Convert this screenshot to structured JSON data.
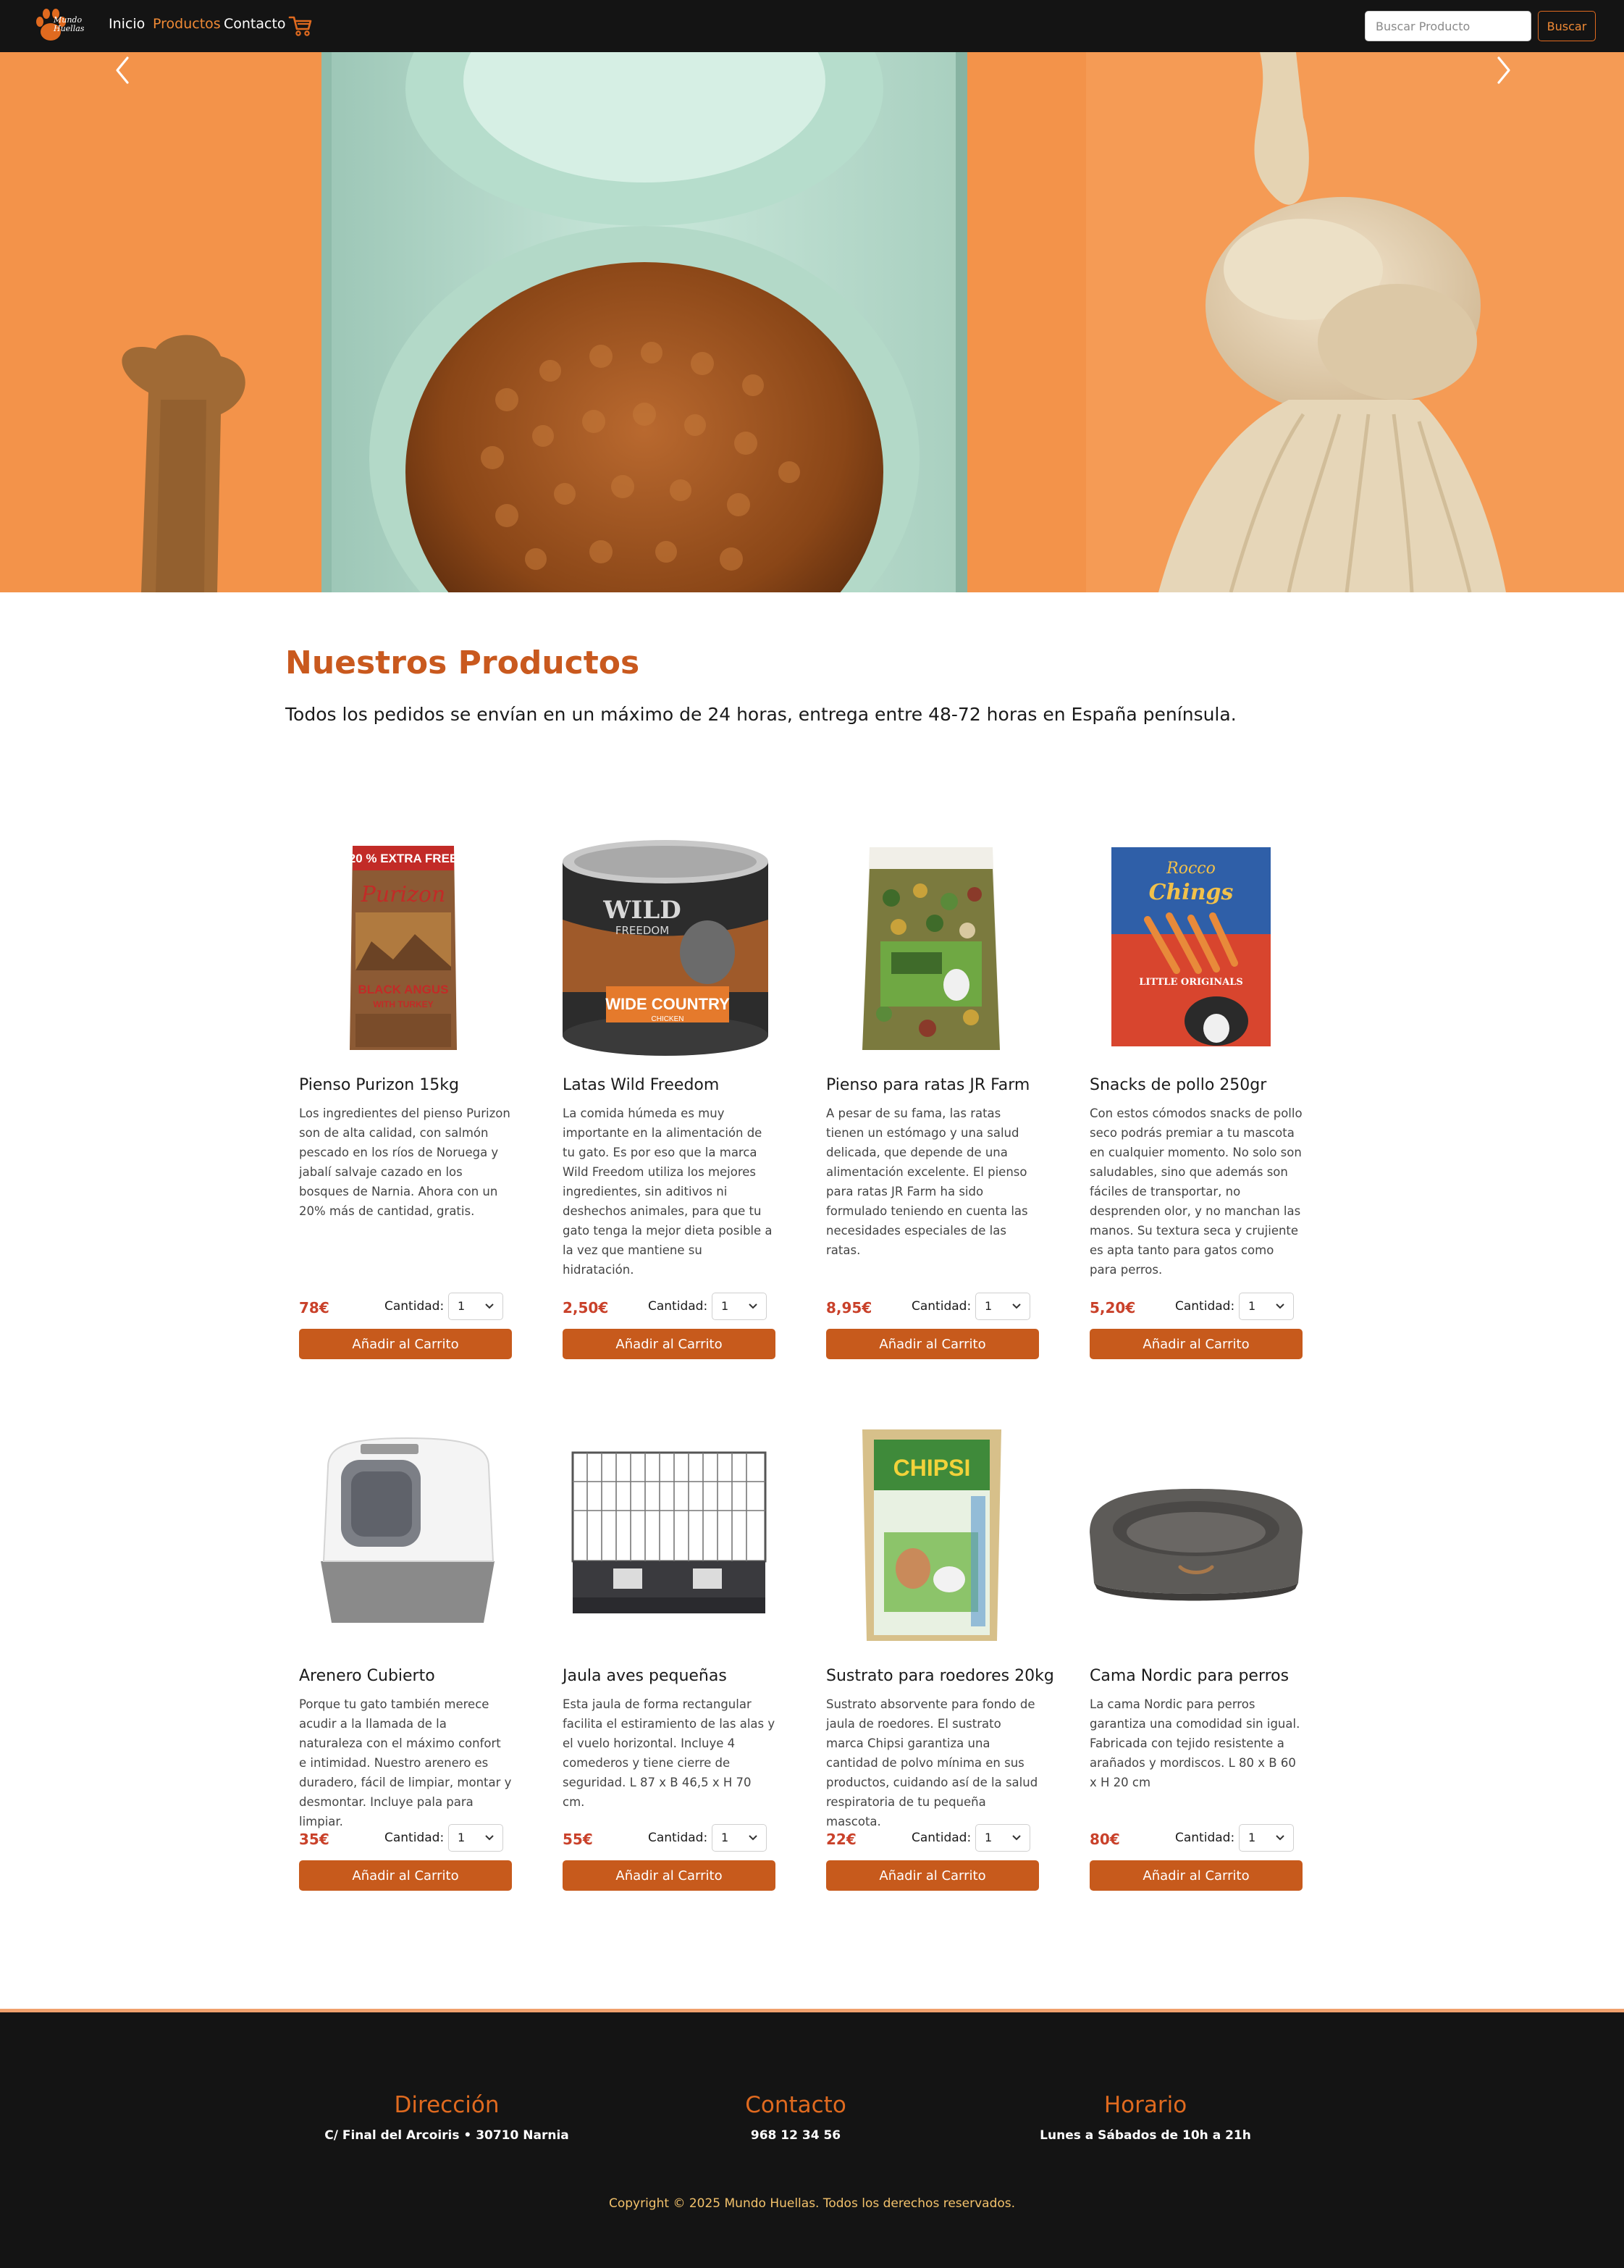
{
  "colors": {
    "accent": "#e06a1f",
    "button": "#c75a1c",
    "price": "#c9412a",
    "navbar": "#141414"
  },
  "navbar": {
    "brand": "Mundo Huellas",
    "links": [
      "Inicio",
      "Productos",
      "Contacto"
    ],
    "active_link": "Productos",
    "search_placeholder": "Buscar Producto",
    "search_button": "Buscar",
    "icons": [
      "paw-logo-icon",
      "cart-icon"
    ]
  },
  "hero": {
    "icons": [
      "chevron-left-icon",
      "chevron-right-icon"
    ]
  },
  "section": {
    "title": "Nuestros Productos",
    "subtitle": "Todos los pedidos se envían en un máximo de 24 horas, entrega entre 48-72 horas en España península."
  },
  "products_common": {
    "qty_label": "Cantidad:",
    "qty_value": "1",
    "add_label": "Añadir al Carrito"
  },
  "products": [
    {
      "name": "Pienso Purizon 15kg",
      "description": "Los ingredientes del pienso Purizon son de alta calidad, con salmón pescado en los ríos de Noruega y jabalí salvaje cazado en los bosques de Narnia. Ahora con un 20% más de cantidad, gratis.",
      "price": "78€"
    },
    {
      "name": "Latas Wild Freedom",
      "description": "La comida húmeda es muy importante en la alimentación de tu gato. Es por eso que la marca Wild Freedom utiliza los mejores ingredientes, sin aditivos ni deshechos animales, para que tu gato tenga la mejor dieta posible a la vez que mantiene su hidratación.",
      "price": "2,50€"
    },
    {
      "name": "Pienso para ratas JR Farm",
      "description": "A pesar de su fama, las ratas tienen un estómago y una salud delicada, que depende de una alimentación excelente. El pienso para ratas JR Farm ha sido formulado teniendo en cuenta las necesidades especiales de las ratas.",
      "price": "8,95€"
    },
    {
      "name": "Snacks de pollo 250gr",
      "description": "Con estos cómodos snacks de pollo seco podrás premiar a tu mascota en cualquier momento. No solo son saludables, sino que además son fáciles de transportar, no desprenden olor, y no manchan las manos. Su textura seca y crujiente es apta tanto para gatos como para perros.",
      "price": "5,20€"
    },
    {
      "name": "Arenero Cubierto",
      "description": "Porque tu gato también merece acudir a la llamada de la naturaleza con el máximo confort e intimidad. Nuestro arenero es duradero, fácil de limpiar, montar y desmontar. Incluye pala para limpiar.",
      "price": "35€"
    },
    {
      "name": "Jaula aves pequeñas",
      "description": "Esta jaula de forma rectangular facilita el estiramiento de las alas y el vuelo horizontal. Incluye 4 comederos y tiene cierre de seguridad. L 87 x B 46,5 x H 70 cm.",
      "price": "55€"
    },
    {
      "name": "Sustrato para roedores 20kg",
      "description": "Sustrato absorvente para fondo de jaula de roedores. El sustrato marca Chipsi garantiza una cantidad de polvo mínima en sus productos, cuidando así de la salud respiratoria de tu pequeña mascota.",
      "price": "22€"
    },
    {
      "name": "Cama Nordic para perros",
      "description": "La cama Nordic para perros garantiza una comodidad sin igual. Fabricada con tejido resistente a arañados y mordiscos. L 80 x B 60 x H 20 cm",
      "price": "80€"
    }
  ],
  "product_images": {
    "packaging_text": [
      "20 % EXTRA FREE",
      "Purizon",
      "BLACK ANGUS",
      "WITH TURKEY",
      "WILD",
      "FREEDOM",
      "WIDE COUNTRY",
      "CHICKEN",
      "Rocco",
      "Chings",
      "LITTLE ORIGINALS",
      "CHIPSI"
    ]
  },
  "footer": {
    "columns": [
      {
        "title": "Dirección",
        "text": "C/ Final del Arcoiris • 30710 Narnia"
      },
      {
        "title": "Contacto",
        "text": "968 12 34 56"
      },
      {
        "title": "Horario",
        "text": "Lunes a Sábados de 10h a 21h"
      }
    ],
    "copyright": "Copyright © 2025 Mundo Huellas. Todos los derechos reservados."
  }
}
